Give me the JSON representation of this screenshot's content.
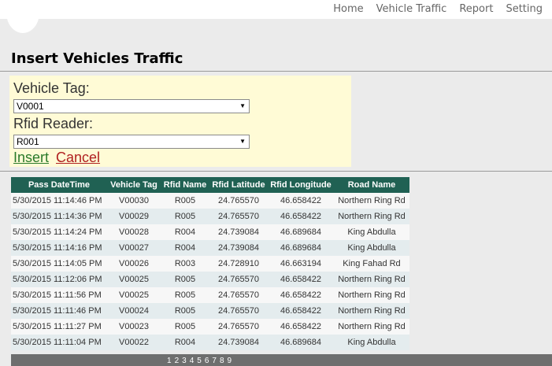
{
  "nav": {
    "items": [
      "Home",
      "Vehicle Traffic",
      "Report",
      "Setting"
    ]
  },
  "page": {
    "title": "Insert Vehicles Traffic"
  },
  "form": {
    "vehicle_tag_label": "Vehicle Tag:",
    "vehicle_tag_value": "V0001",
    "rfid_reader_label": "Rfid Reader:",
    "rfid_reader_value": "R001",
    "insert_label": "Insert",
    "cancel_label": "Cancel"
  },
  "table": {
    "columns": [
      "Pass DateTime",
      "Vehicle Tag",
      "Rfid Name",
      "Rfid Latitude",
      "Rfid Longitude",
      "Road Name"
    ],
    "rows": [
      [
        "5/30/2015 11:14:46 PM",
        "V00030",
        "R005",
        "24.765570",
        "46.658422",
        "Northern Ring Rd"
      ],
      [
        "5/30/2015 11:14:36 PM",
        "V00029",
        "R005",
        "24.765570",
        "46.658422",
        "Northern Ring Rd"
      ],
      [
        "5/30/2015 11:14:24 PM",
        "V00028",
        "R004",
        "24.739084",
        "46.689684",
        "King Abdulla"
      ],
      [
        "5/30/2015 11:14:16 PM",
        "V00027",
        "R004",
        "24.739084",
        "46.689684",
        "King Abdulla"
      ],
      [
        "5/30/2015 11:14:05 PM",
        "V00026",
        "R003",
        "24.728910",
        "46.663194",
        "King Fahad Rd"
      ],
      [
        "5/30/2015 11:12:06 PM",
        "V00025",
        "R005",
        "24.765570",
        "46.658422",
        "Northern Ring Rd"
      ],
      [
        "5/30/2015 11:11:56 PM",
        "V00025",
        "R005",
        "24.765570",
        "46.658422",
        "Northern Ring Rd"
      ],
      [
        "5/30/2015 11:11:46 PM",
        "V00024",
        "R005",
        "24.765570",
        "46.658422",
        "Northern Ring Rd"
      ],
      [
        "5/30/2015 11:11:27 PM",
        "V00023",
        "R005",
        "24.765570",
        "46.658422",
        "Northern Ring Rd"
      ],
      [
        "5/30/2015 11:11:04 PM",
        "V00022",
        "R004",
        "24.739084",
        "46.689684",
        "King Abdulla"
      ]
    ]
  },
  "pager": {
    "pages": [
      "1",
      "2",
      "3",
      "4",
      "5",
      "6",
      "7",
      "8",
      "9"
    ]
  },
  "colors": {
    "header_bg": "#206153",
    "form_bg": "#fffbd6",
    "insert_link": "#2a7a2a",
    "cancel_link": "#b02020"
  }
}
